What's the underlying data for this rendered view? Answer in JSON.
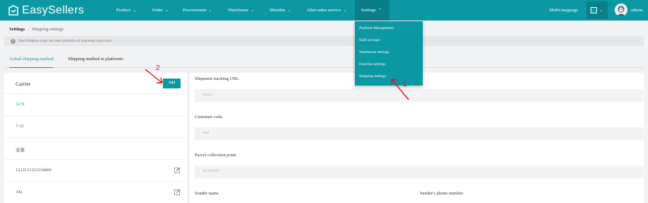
{
  "brand": {
    "name": "EasySellers"
  },
  "nav": {
    "items": [
      {
        "label": "Product",
        "chevron": "⌄"
      },
      {
        "label": "Order",
        "chevron": "⌄"
      },
      {
        "label": "Procurement",
        "chevron": "⌄"
      },
      {
        "label": "Warehouse",
        "chevron": "⌄"
      },
      {
        "label": "Member",
        "chevron": "⌄"
      },
      {
        "label": "After-sales service",
        "chevron": "⌄"
      },
      {
        "label": "Settings",
        "chevron": "⌃"
      }
    ],
    "language": "Multi-language",
    "color_picker_chevron": "⌄",
    "user": "admin"
  },
  "breadcrumb": {
    "root": "Settings",
    "separator": "/",
    "current": "Shipping settings"
  },
  "notice": {
    "icon": "info-icon",
    "text": "Bind Shopline shops and other platforms of importing orders here."
  },
  "tabs": [
    {
      "label": "Actual shipping method"
    },
    {
      "label": "Shipping method in platforms"
    }
  ],
  "carriers": {
    "title": "Carrier",
    "add_label": "Add",
    "items": [
      {
        "name": "ACS",
        "editable": false
      },
      {
        "name": "7-11",
        "editable": false
      },
      {
        "name": "全家",
        "editable": false
      },
      {
        "name": "121212121233dd6f",
        "editable": true
      },
      {
        "name": "342",
        "editable": true
      }
    ]
  },
  "form": {
    "tracking_url_label": "Shipment tracking URL",
    "tracking_url_value": "sssssss",
    "customer_code_label": "Customer code",
    "customer_code_value": "dddf",
    "collection_point_label": "Parcel collection point",
    "collection_point_value": "ACSTWTP",
    "sender_name_label": "Sender name",
    "sender_phone_label": "Sender's phone number"
  },
  "settings_menu": {
    "items": [
      {
        "label": "Platform Management"
      },
      {
        "label": "Staff account"
      },
      {
        "label": "Warehouse settings"
      },
      {
        "label": "Function settings"
      },
      {
        "label": "Shipping settings"
      }
    ]
  },
  "annotations": {
    "step1": "1",
    "step2": "2",
    "color": "#dd1111"
  },
  "colors": {
    "accent": "#0c98a3",
    "accent_dark": "#0a7f89",
    "page_bg": "#f1f2f4"
  }
}
